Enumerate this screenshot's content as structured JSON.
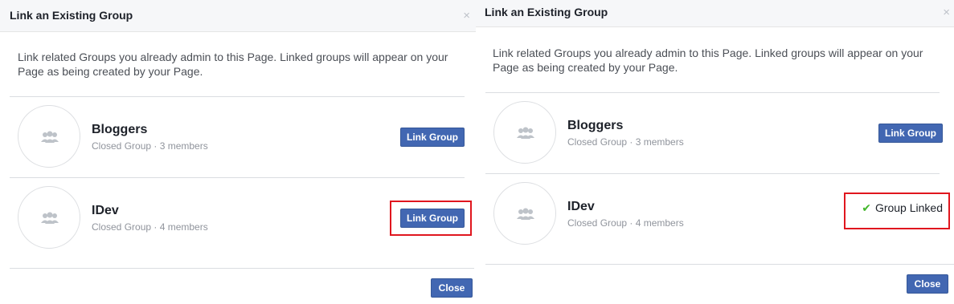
{
  "left_dialog": {
    "title": "Link an Existing Group",
    "close_icon": "×",
    "description": "Link related Groups you already admin to this Page. Linked groups will appear on your Page as being created by your Page.",
    "groups": [
      {
        "name": "Bloggers",
        "meta": "Closed Group · 3 members",
        "button_label": "Link Group"
      },
      {
        "name": "IDev",
        "meta": "Closed Group · 4 members",
        "button_label": "Link Group"
      }
    ],
    "close_label": "Close"
  },
  "right_dialog": {
    "title": "Link an Existing Group",
    "close_icon": "×",
    "description": "Link related Groups you already admin to this Page. Linked groups will appear on your Page as being created by your Page.",
    "groups": [
      {
        "name": "Bloggers",
        "meta": "Closed Group · 3 members",
        "button_label": "Link Group"
      },
      {
        "name": "IDev",
        "meta": "Closed Group · 4 members",
        "status_label": "Group Linked",
        "status_icon": "✔"
      }
    ],
    "close_label": "Close"
  },
  "colors": {
    "button_blue": "#4267b2",
    "highlight_red": "#e0161e",
    "check_green": "#42b72a"
  },
  "icons": [
    "group-icon",
    "close-icon",
    "checkmark-icon"
  ]
}
